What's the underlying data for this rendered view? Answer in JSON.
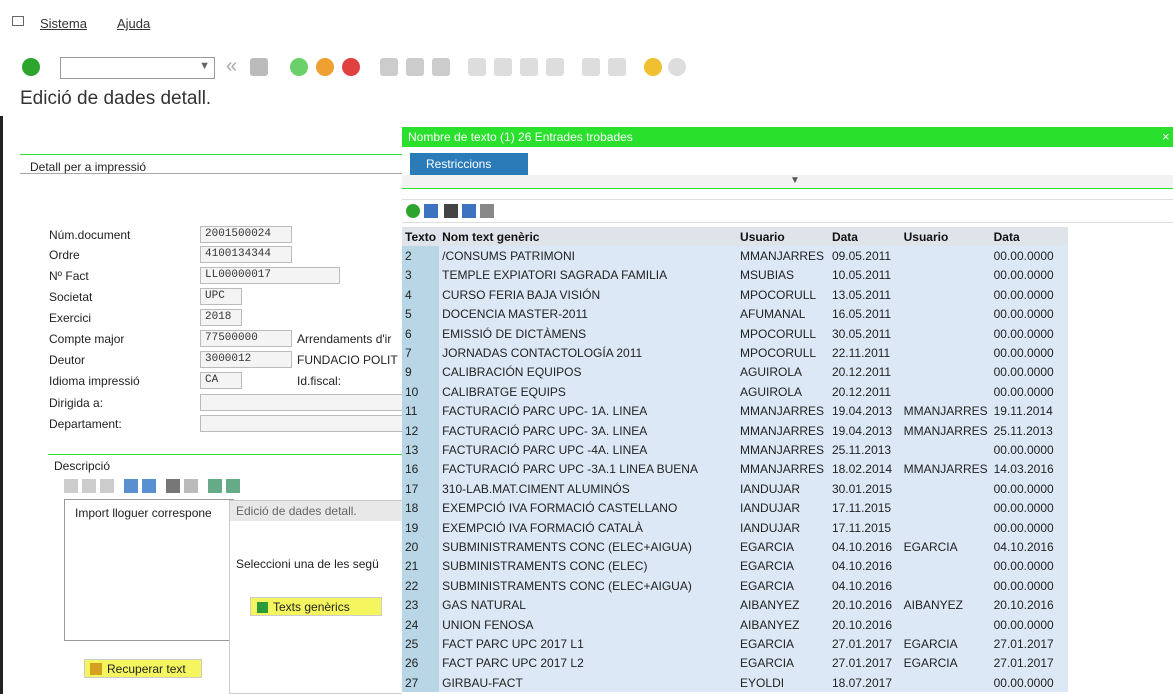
{
  "menu": {
    "items": [
      "Sistema",
      "Ajuda"
    ]
  },
  "title": "Edició de dades detall.",
  "detail": {
    "section_label": "Detall per a impressió",
    "fields": [
      {
        "label": "Núm.document",
        "value": "2001500024"
      },
      {
        "label": "Ordre",
        "value": "4100134344"
      },
      {
        "label": "Nº Fact",
        "value": "LL00000017"
      },
      {
        "label": "Societat",
        "value": "UPC"
      },
      {
        "label": "Exercici",
        "value": "2018"
      },
      {
        "label": "Compte major",
        "value": "77500000",
        "extra": "Arrendaments d'ir"
      },
      {
        "label": "Deutor",
        "value": "3000012",
        "extra": "FUNDACIO POLIT"
      },
      {
        "label": "Idioma impressió",
        "value": "CA",
        "extra": "Id.fiscal:"
      },
      {
        "label": "Dirigida a:",
        "value": ""
      },
      {
        "label": "Departament:",
        "value": ""
      }
    ],
    "descripcio_label": "Descripció",
    "descripcio_text": "Import lloguer correspone",
    "recuperar_label": "Recuperar text"
  },
  "subdialog": {
    "title": "Edició de dades detall.",
    "message": "Seleccioni una de les segü",
    "button": "Texts genèrics"
  },
  "popup": {
    "title": "Nombre de texto (1)   26 Entrades trobades",
    "tab": "Restriccions",
    "columns": [
      "Texto",
      "Nom text genèric",
      "Usuario",
      "Data",
      "Usuario",
      "Data"
    ],
    "rows": [
      [
        "2",
        "/CONSUMS PATRIMONI",
        "MMANJARRES",
        "09.05.2011",
        "",
        "00.00.0000"
      ],
      [
        "3",
        "TEMPLE EXPIATORI SAGRADA FAMILIA",
        "MSUBIAS",
        "10.05.2011",
        "",
        "00.00.0000"
      ],
      [
        "4",
        "CURSO FERIA BAJA VISIÓN",
        "MPOCORULL",
        "13.05.2011",
        "",
        "00.00.0000"
      ],
      [
        "5",
        "DOCENCIA MASTER-2011",
        "AFUMANAL",
        "16.05.2011",
        "",
        "00.00.0000"
      ],
      [
        "6",
        "EMISSIÓ DE DICTÀMENS",
        "MPOCORULL",
        "30.05.2011",
        "",
        "00.00.0000"
      ],
      [
        "7",
        "JORNADAS CONTACTOLOGÍA 2011",
        "MPOCORULL",
        "22.11.2011",
        "",
        "00.00.0000"
      ],
      [
        "9",
        "CALIBRACIÓN EQUIPOS",
        "AGUIROLA",
        "20.12.2011",
        "",
        "00.00.0000"
      ],
      [
        "10",
        "CALIBRATGE EQUIPS",
        "AGUIROLA",
        "20.12.2011",
        "",
        "00.00.0000"
      ],
      [
        "11",
        "FACTURACIÓ PARC UPC- 1A. LINEA",
        "MMANJARRES",
        "19.04.2013",
        "MMANJARRES",
        "19.11.2014"
      ],
      [
        "12",
        "FACTURACIÓ PARC UPC- 3A. LINEA",
        "MMANJARRES",
        "19.04.2013",
        "MMANJARRES",
        "25.11.2013"
      ],
      [
        "13",
        "FACTURACIÓ PARC UPC -4A. LINEA",
        "MMANJARRES",
        "25.11.2013",
        "",
        "00.00.0000"
      ],
      [
        "16",
        "FACTURACIÓ PARC UPC -3A.1 LINEA BUENA",
        "MMANJARRES",
        "18.02.2014",
        "MMANJARRES",
        "14.03.2016"
      ],
      [
        "17",
        "310-LAB.MAT.CIMENT ALUMINÓS",
        "IANDUJAR",
        "30.01.2015",
        "",
        "00.00.0000"
      ],
      [
        "18",
        "EXEMPCIÓ IVA FORMACIÓ CASTELLANO",
        "IANDUJAR",
        "17.11.2015",
        "",
        "00.00.0000"
      ],
      [
        "19",
        "EXEMPCIÓ IVA FORMACIÓ CATALÀ",
        "IANDUJAR",
        "17.11.2015",
        "",
        "00.00.0000"
      ],
      [
        "20",
        "SUBMINISTRAMENTS CONC (ELEC+AIGUA)",
        "EGARCIA",
        "04.10.2016",
        "EGARCIA",
        "04.10.2016"
      ],
      [
        "21",
        "SUBMINISTRAMENTS CONC (ELEC)",
        "EGARCIA",
        "04.10.2016",
        "",
        "00.00.0000"
      ],
      [
        "22",
        "SUBMINISTRAMENTS CONC (ELEC+AIGUA)",
        "EGARCIA",
        "04.10.2016",
        "",
        "00.00.0000"
      ],
      [
        "23",
        "GAS NATURAL",
        "AIBANYEZ",
        "20.10.2016",
        "AIBANYEZ",
        "20.10.2016"
      ],
      [
        "24",
        "UNION FENOSA",
        "AIBANYEZ",
        "20.10.2016",
        "",
        "00.00.0000"
      ],
      [
        "25",
        "FACT PARC UPC 2017 L1",
        "EGARCIA",
        "27.01.2017",
        "EGARCIA",
        "27.01.2017"
      ],
      [
        "26",
        "FACT PARC UPC 2017 L2",
        "EGARCIA",
        "27.01.2017",
        "EGARCIA",
        "27.01.2017"
      ],
      [
        "27",
        "GIRBAU-FACT",
        "EYOLDI",
        "18.07.2017",
        "",
        "00.00.0000"
      ]
    ]
  },
  "colors": {
    "title_green": "#29e02c",
    "tab_blue": "#2b7bb9",
    "grid_bg": "#dce8f5"
  }
}
